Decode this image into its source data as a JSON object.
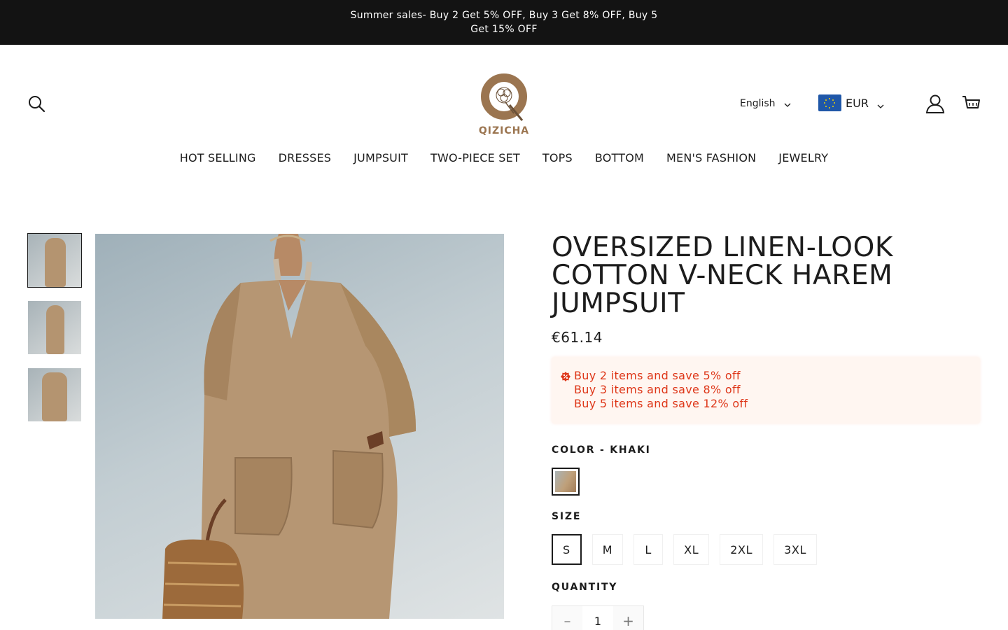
{
  "announcement": {
    "text": "Summer sales- Buy 2 Get 5% OFF, Buy 3 Get 8% OFF, Buy 5 Get 15% OFF"
  },
  "header": {
    "logo_text": "QIZICHA",
    "language": "English",
    "currency": "EUR"
  },
  "nav": {
    "items": [
      {
        "label": "HOT SELLING"
      },
      {
        "label": "DRESSES"
      },
      {
        "label": "JUMPSUIT"
      },
      {
        "label": "TWO-PIECE SET"
      },
      {
        "label": "TOPS"
      },
      {
        "label": "BOTTOM"
      },
      {
        "label": "MEN'S FASHION"
      },
      {
        "label": "JEWELRY"
      }
    ]
  },
  "product": {
    "title": "OVERSIZED LINEN-LOOK COTTON V-NECK HAREM JUMPSUIT",
    "price": "€61.14",
    "promo_lines": [
      "Buy 2 items and save 5% off",
      "Buy 3 items and save 8% off",
      "Buy 5 items and save 12% off"
    ],
    "color_label": "COLOR - KHAKI",
    "size_label": "SIZE",
    "sizes": [
      "S",
      "M",
      "L",
      "XL",
      "2XL",
      "3XL"
    ],
    "selected_size": "S",
    "quantity_label": "QUANTITY",
    "quantity_value": "1"
  },
  "colors": {
    "announcement_bg": "#131313",
    "promo_text": "#de3618",
    "promo_bg": "#fff6f1",
    "logo_brown": "#9b7550",
    "flag_blue": "#1f57a8"
  }
}
